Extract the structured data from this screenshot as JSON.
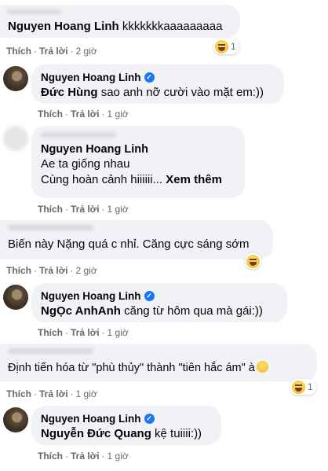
{
  "actions": {
    "like": "Thích",
    "reply": "Trả lời",
    "sep": "·"
  },
  "comments": [
    {
      "author": "Nguyen Hoang Linh",
      "text": "kkkkkkkaaaaaaaaa",
      "time": "2 giờ",
      "reaction_count": "1",
      "reaction_icon": "haha-emoji-icon"
    },
    {
      "author": "Nguyen Hoang Linh",
      "verified": true,
      "mention": "Đức Hùng",
      "text": "sao anh nỡ cười vào mặt em:))",
      "time": "1 giờ"
    },
    {
      "author": "Nguyen Hoang Linh",
      "line1": "Ae ta giống nhau",
      "line2": "Cùng hoàn cảnh hiiiiii...",
      "see_more": "Xem thêm",
      "time": "1 giờ"
    },
    {
      "text": "Biến này Nặng quá c nhỉ. Căng cực sáng sớm",
      "time": "2 giờ",
      "reaction_icon": "haha-emoji-icon"
    },
    {
      "author": "Nguyen Hoang Linh",
      "verified": true,
      "mention": "NgỌc AnhAnh",
      "text": "căng từ hôm qua mà gái:))",
      "time": "1 giờ"
    },
    {
      "text": "Định tiến hóa từ \"phù thủy\" thành \"tiên hắc ám\" à",
      "time": "1 giờ",
      "reaction_count": "1",
      "reaction_icon": "haha-emoji-icon"
    },
    {
      "author": "Nguyen Hoang Linh",
      "verified": true,
      "mention": "Nguyễn Đức Quang",
      "text": "kệ tuiiii:))",
      "time": "1 giờ"
    }
  ],
  "colors": {
    "bubble": "#f0f2f5",
    "meta": "#65676b",
    "verified": "#1877f2",
    "text": "#050505"
  }
}
